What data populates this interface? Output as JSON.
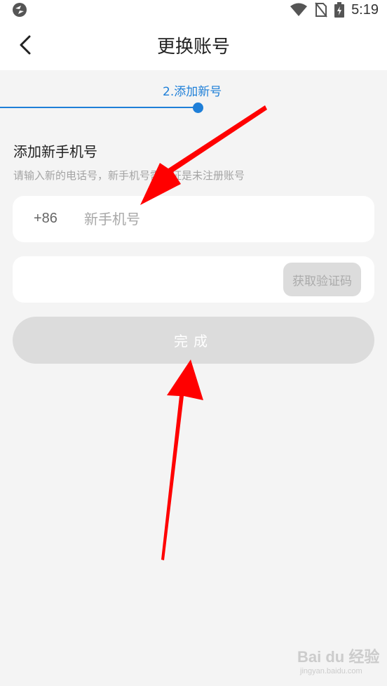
{
  "status_bar": {
    "time": "5:19"
  },
  "header": {
    "title": "更换账号"
  },
  "stepper": {
    "current_step_label": "2.添加新号",
    "accent_color": "#1e7fd8"
  },
  "form": {
    "title": "添加新手机号",
    "hint": "请输入新的电话号，新手机号需保证是未注册账号",
    "country_code": "+86",
    "phone_placeholder": "新手机号",
    "phone_value": "",
    "code_value": "",
    "get_code_label": "获取验证码",
    "submit_label": "完成"
  },
  "watermark": {
    "brand": "Bai du 经验",
    "url": "jingyan.baidu.com"
  },
  "annotation_color": "#ff0000"
}
